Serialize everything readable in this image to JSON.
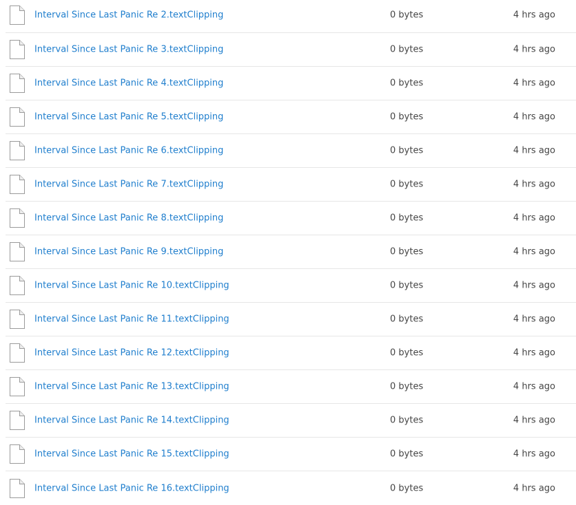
{
  "files": [
    {
      "name": "Interval Since Last Panic Re 2.textClipping",
      "size": "0 bytes",
      "modified": "4 hrs ago",
      "icon": "generic-file-icon"
    },
    {
      "name": "Interval Since Last Panic Re 3.textClipping",
      "size": "0 bytes",
      "modified": "4 hrs ago",
      "icon": "generic-file-icon"
    },
    {
      "name": "Interval Since Last Panic Re 4.textClipping",
      "size": "0 bytes",
      "modified": "4 hrs ago",
      "icon": "generic-file-icon"
    },
    {
      "name": "Interval Since Last Panic Re 5.textClipping",
      "size": "0 bytes",
      "modified": "4 hrs ago",
      "icon": "generic-file-icon"
    },
    {
      "name": "Interval Since Last Panic Re 6.textClipping",
      "size": "0 bytes",
      "modified": "4 hrs ago",
      "icon": "generic-file-icon"
    },
    {
      "name": "Interval Since Last Panic Re 7.textClipping",
      "size": "0 bytes",
      "modified": "4 hrs ago",
      "icon": "generic-file-icon"
    },
    {
      "name": "Interval Since Last Panic Re 8.textClipping",
      "size": "0 bytes",
      "modified": "4 hrs ago",
      "icon": "generic-file-icon"
    },
    {
      "name": "Interval Since Last Panic Re 9.textClipping",
      "size": "0 bytes",
      "modified": "4 hrs ago",
      "icon": "generic-file-icon"
    },
    {
      "name": "Interval Since Last Panic Re 10.textClipping",
      "size": "0 bytes",
      "modified": "4 hrs ago",
      "icon": "generic-file-icon"
    },
    {
      "name": "Interval Since Last Panic Re 11.textClipping",
      "size": "0 bytes",
      "modified": "4 hrs ago",
      "icon": "generic-file-icon"
    },
    {
      "name": "Interval Since Last Panic Re 12.textClipping",
      "size": "0 bytes",
      "modified": "4 hrs ago",
      "icon": "generic-file-icon"
    },
    {
      "name": "Interval Since Last Panic Re 13.textClipping",
      "size": "0 bytes",
      "modified": "4 hrs ago",
      "icon": "generic-file-icon"
    },
    {
      "name": "Interval Since Last Panic Re 14.textClipping",
      "size": "0 bytes",
      "modified": "4 hrs ago",
      "icon": "generic-file-icon"
    },
    {
      "name": "Interval Since Last Panic Re 15.textClipping",
      "size": "0 bytes",
      "modified": "4 hrs ago",
      "icon": "generic-file-icon"
    },
    {
      "name": "Interval Since Last Panic Re 16.textClipping",
      "size": "0 bytes",
      "modified": "4 hrs ago",
      "icon": "generic-file-icon"
    }
  ],
  "colors": {
    "link": "#1f7ecd",
    "text": "#444444",
    "divider": "#e6e6e6"
  }
}
